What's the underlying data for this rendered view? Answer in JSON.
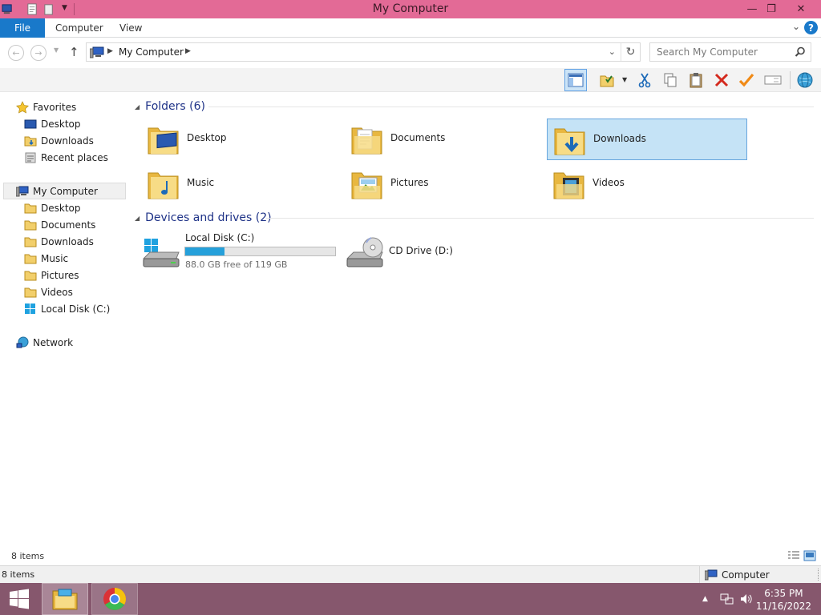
{
  "window": {
    "title": "My Computer"
  },
  "ribbon": {
    "tabs": [
      {
        "label": "File"
      },
      {
        "label": "Computer"
      },
      {
        "label": "View"
      }
    ]
  },
  "address": {
    "crumb": "My Computer"
  },
  "search": {
    "placeholder": "Search My Computer"
  },
  "navpane": {
    "favorites_label": "Favorites",
    "favorites": [
      {
        "label": "Desktop",
        "icon": "desktop-icon"
      },
      {
        "label": "Downloads",
        "icon": "downloads-folder-icon"
      },
      {
        "label": "Recent places",
        "icon": "recent-places-icon"
      }
    ],
    "computer_label": "My Computer",
    "computer": [
      {
        "label": "Desktop",
        "icon": "folder-icon"
      },
      {
        "label": "Documents",
        "icon": "folder-icon"
      },
      {
        "label": "Downloads",
        "icon": "folder-icon"
      },
      {
        "label": "Music",
        "icon": "folder-icon"
      },
      {
        "label": "Pictures",
        "icon": "folder-icon"
      },
      {
        "label": "Videos",
        "icon": "folder-icon"
      },
      {
        "label": "Local Disk (C:)",
        "icon": "local-disk-icon"
      }
    ],
    "network_label": "Network"
  },
  "content": {
    "folders_header": "Folders (6)",
    "folders": [
      {
        "label": "Desktop",
        "icon": "desktop-folder-icon"
      },
      {
        "label": "Documents",
        "icon": "documents-folder-icon"
      },
      {
        "label": "Downloads",
        "icon": "downloads-folder-icon",
        "selected": true
      },
      {
        "label": "Music",
        "icon": "music-folder-icon"
      },
      {
        "label": "Pictures",
        "icon": "pictures-folder-icon"
      },
      {
        "label": "Videos",
        "icon": "videos-folder-icon"
      }
    ],
    "drives_header": "Devices and drives (2)",
    "drives": [
      {
        "name": "Local Disk (C:)",
        "free_text": "88.0 GB free of 119 GB",
        "used_fraction": 0.26,
        "icon": "hard-disk-icon"
      },
      {
        "name": "CD Drive (D:)",
        "icon": "cd-drive-icon"
      }
    ]
  },
  "status": {
    "items_count": "8 items",
    "items_count_bottom": "8 items",
    "zone": "Computer"
  },
  "taskbar": {
    "time": "6:35 PM",
    "date": "11/16/2022"
  },
  "colors": {
    "titlebar": "#e36a96",
    "file_tab": "#1979ca",
    "taskbar": "#86576d",
    "selection": "#c5e3f6",
    "group_header": "#1e3287"
  }
}
